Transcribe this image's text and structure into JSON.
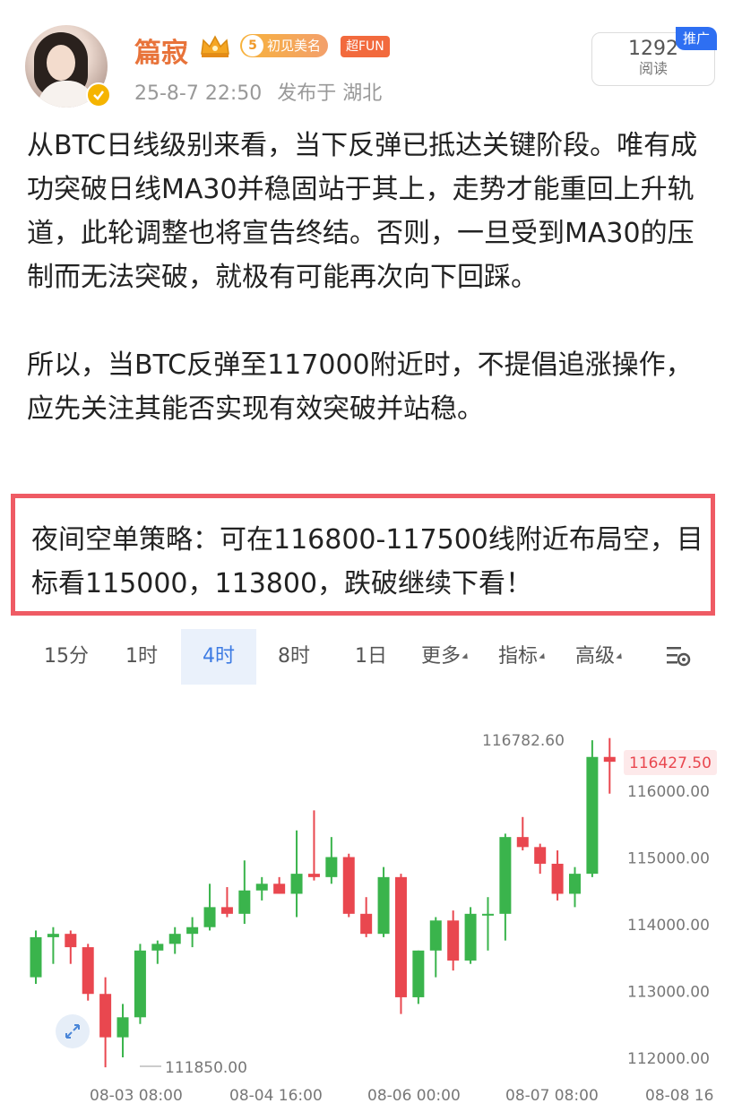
{
  "user": {
    "name": "篇寂",
    "level": "5",
    "badge_level_label": "初见美名",
    "badge_fun": "超FUN",
    "date": "25-8-7 22:50",
    "location": "发布于 湖北"
  },
  "reads": {
    "count": "1292",
    "label": "阅读",
    "promo": "推广"
  },
  "post": {
    "paragraph1": "从BTC日线级别来看，当下反弹已抵达关键阶段。唯有成功突破日线MA30并稳固站于其上，走势才能重回上升轨道，此轮调整也将宣告终结。否则，一旦受到MA30的压制而无法突破，就极有可能再次向下回踩。",
    "paragraph2": "所以，当BTC反弹至117000附近时，不提倡追涨操作，应先关注其能否实现有效突破并站稳。",
    "strategy": "夜间空单策略：可在116800-117500线附近布局空，目标看115000，113800，跌破继续下看！"
  },
  "toolbar": {
    "tabs": [
      "15分",
      "1时",
      "4时",
      "8时",
      "1日",
      "更多",
      "指标",
      "高级"
    ],
    "active": "4时"
  },
  "colors": {
    "up": "#3ab44c",
    "down": "#e9474f",
    "accent": "#3d7be3",
    "name": "#e8733a",
    "highlight_border": "#ef5b64"
  },
  "chart_data": {
    "type": "candlestick",
    "y_ticks": [
      "116000.00",
      "115000.00",
      "114000.00",
      "113000.00",
      "112000.00"
    ],
    "x_ticks": [
      "08-03 08:00",
      "08-04 16:00",
      "08-06 00:00",
      "08-07 08:00",
      "08-08 16"
    ],
    "ylim": [
      111800,
      117000
    ],
    "high_label": "116782.60",
    "low_label": "111850.00",
    "current_price": "116427.50",
    "candles": [
      {
        "o": 113200,
        "h": 113900,
        "l": 113100,
        "c": 113800
      },
      {
        "o": 113800,
        "h": 113950,
        "l": 113400,
        "c": 113850
      },
      {
        "o": 113850,
        "h": 113900,
        "l": 113400,
        "c": 113650
      },
      {
        "o": 113650,
        "h": 113700,
        "l": 112850,
        "c": 112950
      },
      {
        "o": 112950,
        "h": 113200,
        "l": 111850,
        "c": 112300
      },
      {
        "o": 112300,
        "h": 112800,
        "l": 112000,
        "c": 112600
      },
      {
        "o": 112600,
        "h": 113700,
        "l": 112500,
        "c": 113600
      },
      {
        "o": 113600,
        "h": 113750,
        "l": 113400,
        "c": 113700
      },
      {
        "o": 113700,
        "h": 113950,
        "l": 113550,
        "c": 113850
      },
      {
        "o": 113850,
        "h": 114100,
        "l": 113650,
        "c": 113950
      },
      {
        "o": 113950,
        "h": 114600,
        "l": 113900,
        "c": 114250
      },
      {
        "o": 114250,
        "h": 114550,
        "l": 114100,
        "c": 114150
      },
      {
        "o": 114150,
        "h": 114950,
        "l": 114000,
        "c": 114500
      },
      {
        "o": 114500,
        "h": 114700,
        "l": 114350,
        "c": 114600
      },
      {
        "o": 114600,
        "h": 114700,
        "l": 114450,
        "c": 114450
      },
      {
        "o": 114450,
        "h": 115400,
        "l": 114100,
        "c": 114750
      },
      {
        "o": 114750,
        "h": 115700,
        "l": 114650,
        "c": 114700
      },
      {
        "o": 114700,
        "h": 115300,
        "l": 114600,
        "c": 115000
      },
      {
        "o": 115000,
        "h": 115050,
        "l": 114100,
        "c": 114150
      },
      {
        "o": 114150,
        "h": 114400,
        "l": 113800,
        "c": 113850
      },
      {
        "o": 113850,
        "h": 114850,
        "l": 113800,
        "c": 114700
      },
      {
        "o": 114700,
        "h": 114750,
        "l": 112650,
        "c": 112900
      },
      {
        "o": 112900,
        "h": 113600,
        "l": 112800,
        "c": 113600
      },
      {
        "o": 113600,
        "h": 114100,
        "l": 113200,
        "c": 114050
      },
      {
        "o": 114050,
        "h": 114200,
        "l": 113300,
        "c": 113450
      },
      {
        "o": 113450,
        "h": 114250,
        "l": 113400,
        "c": 114150
      },
      {
        "o": 114150,
        "h": 114400,
        "l": 113600,
        "c": 114150
      },
      {
        "o": 114150,
        "h": 115350,
        "l": 113750,
        "c": 115300
      },
      {
        "o": 115300,
        "h": 115600,
        "l": 115100,
        "c": 115150
      },
      {
        "o": 115150,
        "h": 115200,
        "l": 114750,
        "c": 114900
      },
      {
        "o": 114900,
        "h": 115100,
        "l": 114350,
        "c": 114450
      },
      {
        "o": 114450,
        "h": 114850,
        "l": 114250,
        "c": 114750
      },
      {
        "o": 114750,
        "h": 116750,
        "l": 114700,
        "c": 116500
      },
      {
        "o": 116500,
        "h": 116782.6,
        "l": 115950,
        "c": 116427.5
      }
    ]
  }
}
